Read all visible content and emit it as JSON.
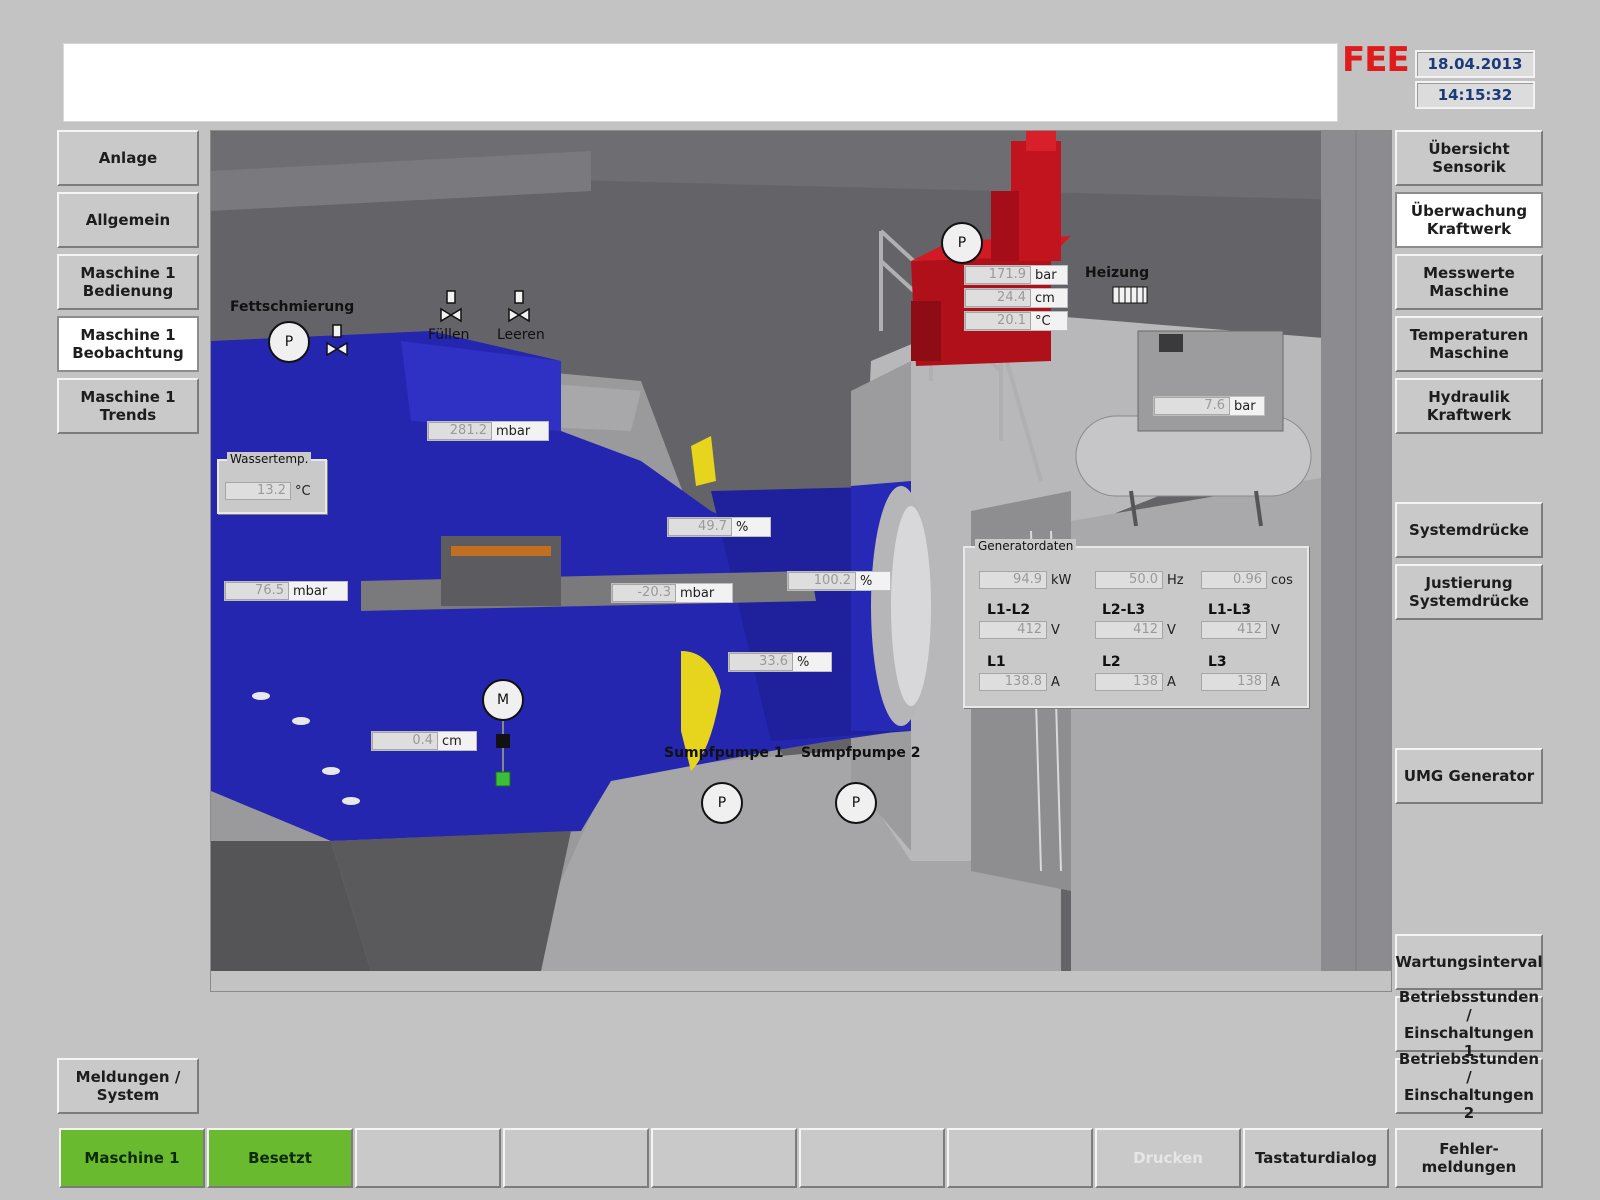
{
  "header": {
    "logo": "FEE",
    "date": "18.04.2013",
    "time": "14:15:32"
  },
  "left_nav": [
    {
      "label": "Anlage",
      "active": false
    },
    {
      "label": "Allgemein",
      "active": false
    },
    {
      "label": "Maschine 1\nBedienung",
      "active": false
    },
    {
      "label": "Maschine 1\nBeobachtung",
      "active": true
    },
    {
      "label": "Maschine 1\nTrends",
      "active": false
    }
  ],
  "left_bottom": {
    "label": "Meldungen /\nSystem"
  },
  "right_nav": [
    {
      "label": "Übersicht\nSensorik",
      "active": false
    },
    {
      "label": "Überwachung\nKraftwerk",
      "active": true
    },
    {
      "label": "Messwerte\nMaschine",
      "active": false
    },
    {
      "label": "Temperaturen\nMaschine",
      "active": false
    },
    {
      "label": "Hydraulik\nKraftwerk",
      "active": false
    },
    {
      "label": "Systemdrücke",
      "active": false
    },
    {
      "label": "Justierung\nSystemdrücke",
      "active": false
    },
    {
      "label": "UMG Generator",
      "active": false
    },
    {
      "label": "Wartungsinterval",
      "active": false
    },
    {
      "label": "Betriebsstunden /\nEinschaltungen 1",
      "active": false
    },
    {
      "label": "Betriebsstunden /\nEinschaltungen 2",
      "active": false
    }
  ],
  "bottom_bar": [
    {
      "label": "Maschine 1",
      "state": "green"
    },
    {
      "label": "Besetzt",
      "state": "green"
    },
    {
      "label": "",
      "state": "normal"
    },
    {
      "label": "",
      "state": "normal"
    },
    {
      "label": "",
      "state": "normal"
    },
    {
      "label": "",
      "state": "normal"
    },
    {
      "label": "",
      "state": "normal"
    },
    {
      "label": "Drucken",
      "state": "disabled"
    },
    {
      "label": "Tastaturdialog",
      "state": "normal"
    },
    {
      "label": "Fehler-\nmeldungen",
      "state": "normal"
    }
  ],
  "scene": {
    "labels": {
      "fettschmierung": "Fettschmierung",
      "fuellen": "Füllen",
      "leeren": "Leeren",
      "heizung": "Heizung",
      "sumpfpumpe1": "Sumpfpumpe 1",
      "sumpfpumpe2": "Sumpfpumpe 2"
    },
    "symbols": {
      "pump": "P",
      "motor": "M"
    },
    "wassertemp": {
      "title": "Wassertemp.",
      "value": "13.2",
      "unit": "°C"
    },
    "readings": {
      "mbar_top": {
        "value": "281.2",
        "unit": "mbar"
      },
      "pct_yellow": {
        "value": "49.7",
        "unit": "%"
      },
      "mbar_left": {
        "value": "76.5",
        "unit": "mbar"
      },
      "mbar_shaft": {
        "value": "-20.3",
        "unit": "mbar"
      },
      "pct_right": {
        "value": "100.2",
        "unit": "%"
      },
      "pct_lower": {
        "value": "33.6",
        "unit": "%"
      },
      "cm_motor": {
        "value": "0.4",
        "unit": "cm"
      },
      "hyd_bar": {
        "value": "171.9",
        "unit": "bar"
      },
      "hyd_cm": {
        "value": "24.4",
        "unit": "cm"
      },
      "hyd_c": {
        "value": "20.1",
        "unit": "°C"
      },
      "comp_bar": {
        "value": "7.6",
        "unit": "bar"
      }
    },
    "generator": {
      "title": "Generatordaten",
      "kw": {
        "value": "94.9",
        "unit": "kW"
      },
      "hz": {
        "value": "50.0",
        "unit": "Hz"
      },
      "cos": {
        "value": "0.96",
        "unit": "cos"
      },
      "l1l2": {
        "label": "L1-L2",
        "value": "412",
        "unit": "V"
      },
      "l2l3": {
        "label": "L2-L3",
        "value": "412",
        "unit": "V"
      },
      "l1l3": {
        "label": "L1-L3",
        "value": "412",
        "unit": "V"
      },
      "l1": {
        "label": "L1",
        "value": "138.8",
        "unit": "A"
      },
      "l2": {
        "label": "L2",
        "value": "138",
        "unit": "A"
      },
      "l3": {
        "label": "L3",
        "value": "138",
        "unit": "A"
      }
    },
    "colors": {
      "turbine": "#2426b0",
      "hydraulic_unit": "#c0141c",
      "valve_yellow": "#e6d51c",
      "indicator_green": "#3bbf3b"
    }
  }
}
